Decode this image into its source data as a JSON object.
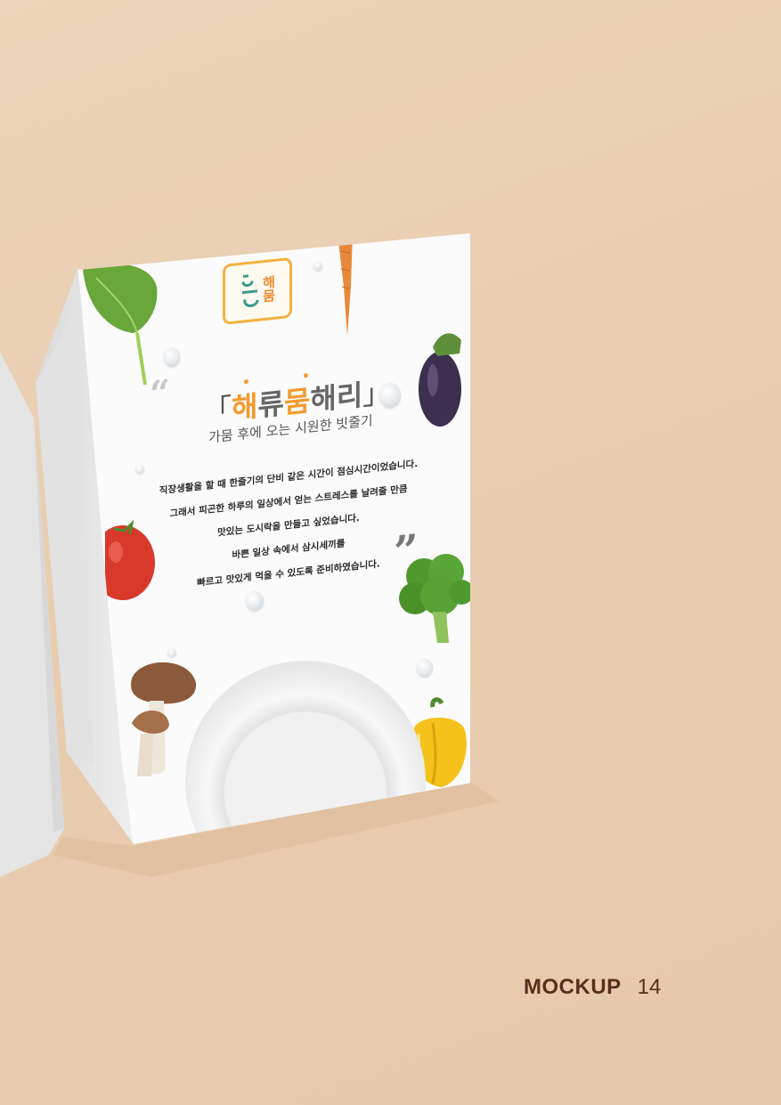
{
  "card": {
    "logo_text": [
      "해",
      "뭄"
    ],
    "quote_open": "“",
    "quote_close": "”",
    "title_bracket_open": "「",
    "title_parts": [
      "해",
      "류",
      "뭄",
      "해리"
    ],
    "title_bracket_close": "」",
    "subtitle": "가뭄 후에 오는 시원한 빗줄기",
    "body_lines": [
      "직장생활을 할 때 한줄기의 단비 같은 시간이 점심시간이었습니다.",
      "그래서 피곤한 하루의 일상에서 얻는 스트레스를 날려줄 만큼",
      "맛있는 도시락을 만들고 싶었습니다.",
      "바쁜 일상 속에서 삼시세끼를",
      "빠르고 맛있게 먹을 수 있도록 준비하였습니다."
    ]
  },
  "footer": {
    "label": "MOCKUP",
    "page_number": "14"
  },
  "colors": {
    "background": "#e9cdb0",
    "accent_orange": "#f49a2d",
    "accent_teal": "#3c9a8b",
    "label_brown": "#5a2e1e"
  }
}
